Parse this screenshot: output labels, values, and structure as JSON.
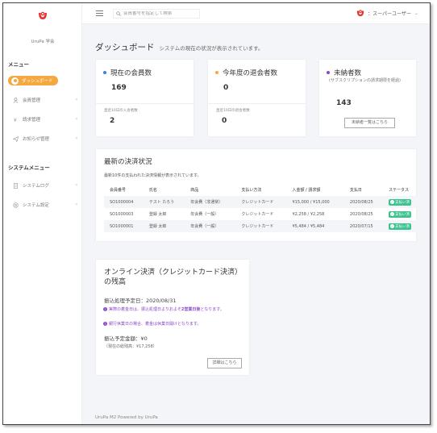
{
  "colors": {
    "accent": "#f5a740",
    "brand": "#e5332a",
    "success": "#3cc28e",
    "note": "#8a48c7",
    "dot_blue": "#3e7fd9",
    "dot_orange": "#f5a740",
    "dot_purple": "#8a48c7"
  },
  "sidebar": {
    "org_name": "UruPa 学会",
    "menu_title": "メニュー",
    "system_menu_title": "システムメニュー",
    "items": [
      {
        "label": "ダッシュボード",
        "icon": "dashboard-icon"
      },
      {
        "label": "会員管理",
        "icon": "user-icon"
      },
      {
        "label": "請求管理",
        "icon": "bill-icon"
      },
      {
        "label": "お知らせ管理",
        "icon": "send-icon"
      }
    ],
    "system_items": [
      {
        "label": "システムログ",
        "icon": "document-icon"
      },
      {
        "label": "システム設定",
        "icon": "settings-icon"
      }
    ]
  },
  "header": {
    "search_placeholder": "会員番号を指定して検索",
    "user_label": "：スーパーユーザー"
  },
  "page": {
    "title": "ダッシュボード",
    "subtitle": "システムの現在の状況が表示されています。"
  },
  "stats": [
    {
      "title": "現在の会員数",
      "value": "169",
      "sub_label": "直近10日の入会者数",
      "sub_value": "2"
    },
    {
      "title": "今年度の退会者数",
      "value": "0",
      "sub_label": "直近10日の退会者数",
      "sub_value": "0"
    },
    {
      "title": "未納者数",
      "subtitle": "(サブスクリプションの請求期限を経過)",
      "value": "143",
      "button": "未納者一覧はこちら"
    }
  ],
  "payments": {
    "title": "最新の決済状況",
    "description": "最新10件の支払われた決済情報が表示されています。",
    "columns": [
      "会員番号",
      "氏名",
      "商品",
      "支払い方法",
      "入金額 / 請求額",
      "支払日",
      "ステータス"
    ],
    "rows": [
      [
        "SO1000004",
        "テスト たろう",
        "年会費（非通常）",
        "クレジットカード",
        "¥15,000 / ¥15,000",
        "2020/08/25",
        "支払い済"
      ],
      [
        "SO1000003",
        "登録 太郎",
        "年会費（一般）",
        "クレジットカード",
        "¥2,258 / ¥2,258",
        "2020/08/25",
        "支払い済"
      ],
      [
        "SO1000001",
        "登録 太郎",
        "年会費（一般）",
        "クレジットカード",
        "¥5,484 / ¥5,484",
        "2020/07/15",
        "支払い済"
      ]
    ]
  },
  "online": {
    "title": "オンライン決済（クレジットカード決済）の残高",
    "transfer_date": "振込処理予定日：2020/08/31",
    "note1_pre": "実際の着金日は、振込処理日よりおよそ",
    "note1_bold": "2営業日後",
    "note1_post": "となります。",
    "note2": "銀行休業日の場合、着金は休業日開けとなります。",
    "amount": "振込予定金額：¥0",
    "total": "（現在の総残高：¥17,258）",
    "button": "詳細はこちら"
  },
  "footer": "UruPa M2 Powered by UruPa"
}
